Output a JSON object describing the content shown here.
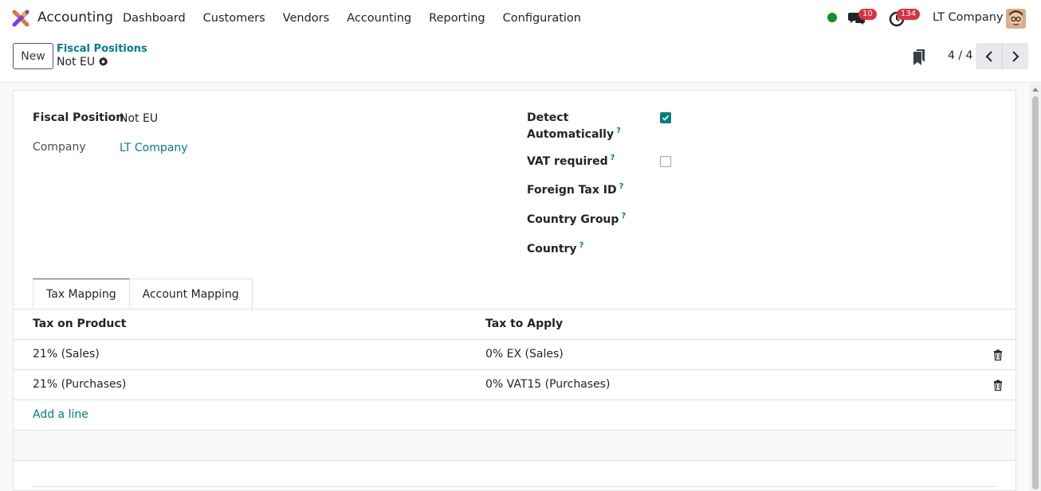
{
  "navbar": {
    "app_name": "Accounting",
    "menu": [
      "Dashboard",
      "Customers",
      "Vendors",
      "Accounting",
      "Reporting",
      "Configuration"
    ],
    "chat_count": "10",
    "activity_count": "134",
    "company": "LT Company"
  },
  "control_panel": {
    "new_label": "New",
    "breadcrumb": "Fiscal Positions",
    "record_name": "Not EU",
    "pager": "4 / 4"
  },
  "form": {
    "fiscal_position_label": "Fiscal Position",
    "fiscal_position_value": "Not EU",
    "company_label": "Company",
    "company_value": "LT Company",
    "detect_label_1": "Detect",
    "detect_label_2": "Automatically",
    "detect_checked": true,
    "vat_required_label": "VAT required",
    "vat_required_checked": false,
    "foreign_tax_label": "Foreign Tax ID",
    "country_group_label": "Country Group",
    "country_label": "Country",
    "help_mark": "?"
  },
  "tabs": [
    "Tax Mapping",
    "Account Mapping"
  ],
  "table": {
    "headers": [
      "Tax on Product",
      "Tax to Apply"
    ],
    "rows": [
      [
        "21% (Sales)",
        "0% EX (Sales)"
      ],
      [
        "21% (Purchases)",
        "0% VAT15 (Purchases)"
      ]
    ],
    "add_line": "Add a line"
  },
  "colors": {
    "primary": "#714b67",
    "link": "#017e84",
    "badge": "#d9333f",
    "status_online": "#1f8a1f"
  }
}
